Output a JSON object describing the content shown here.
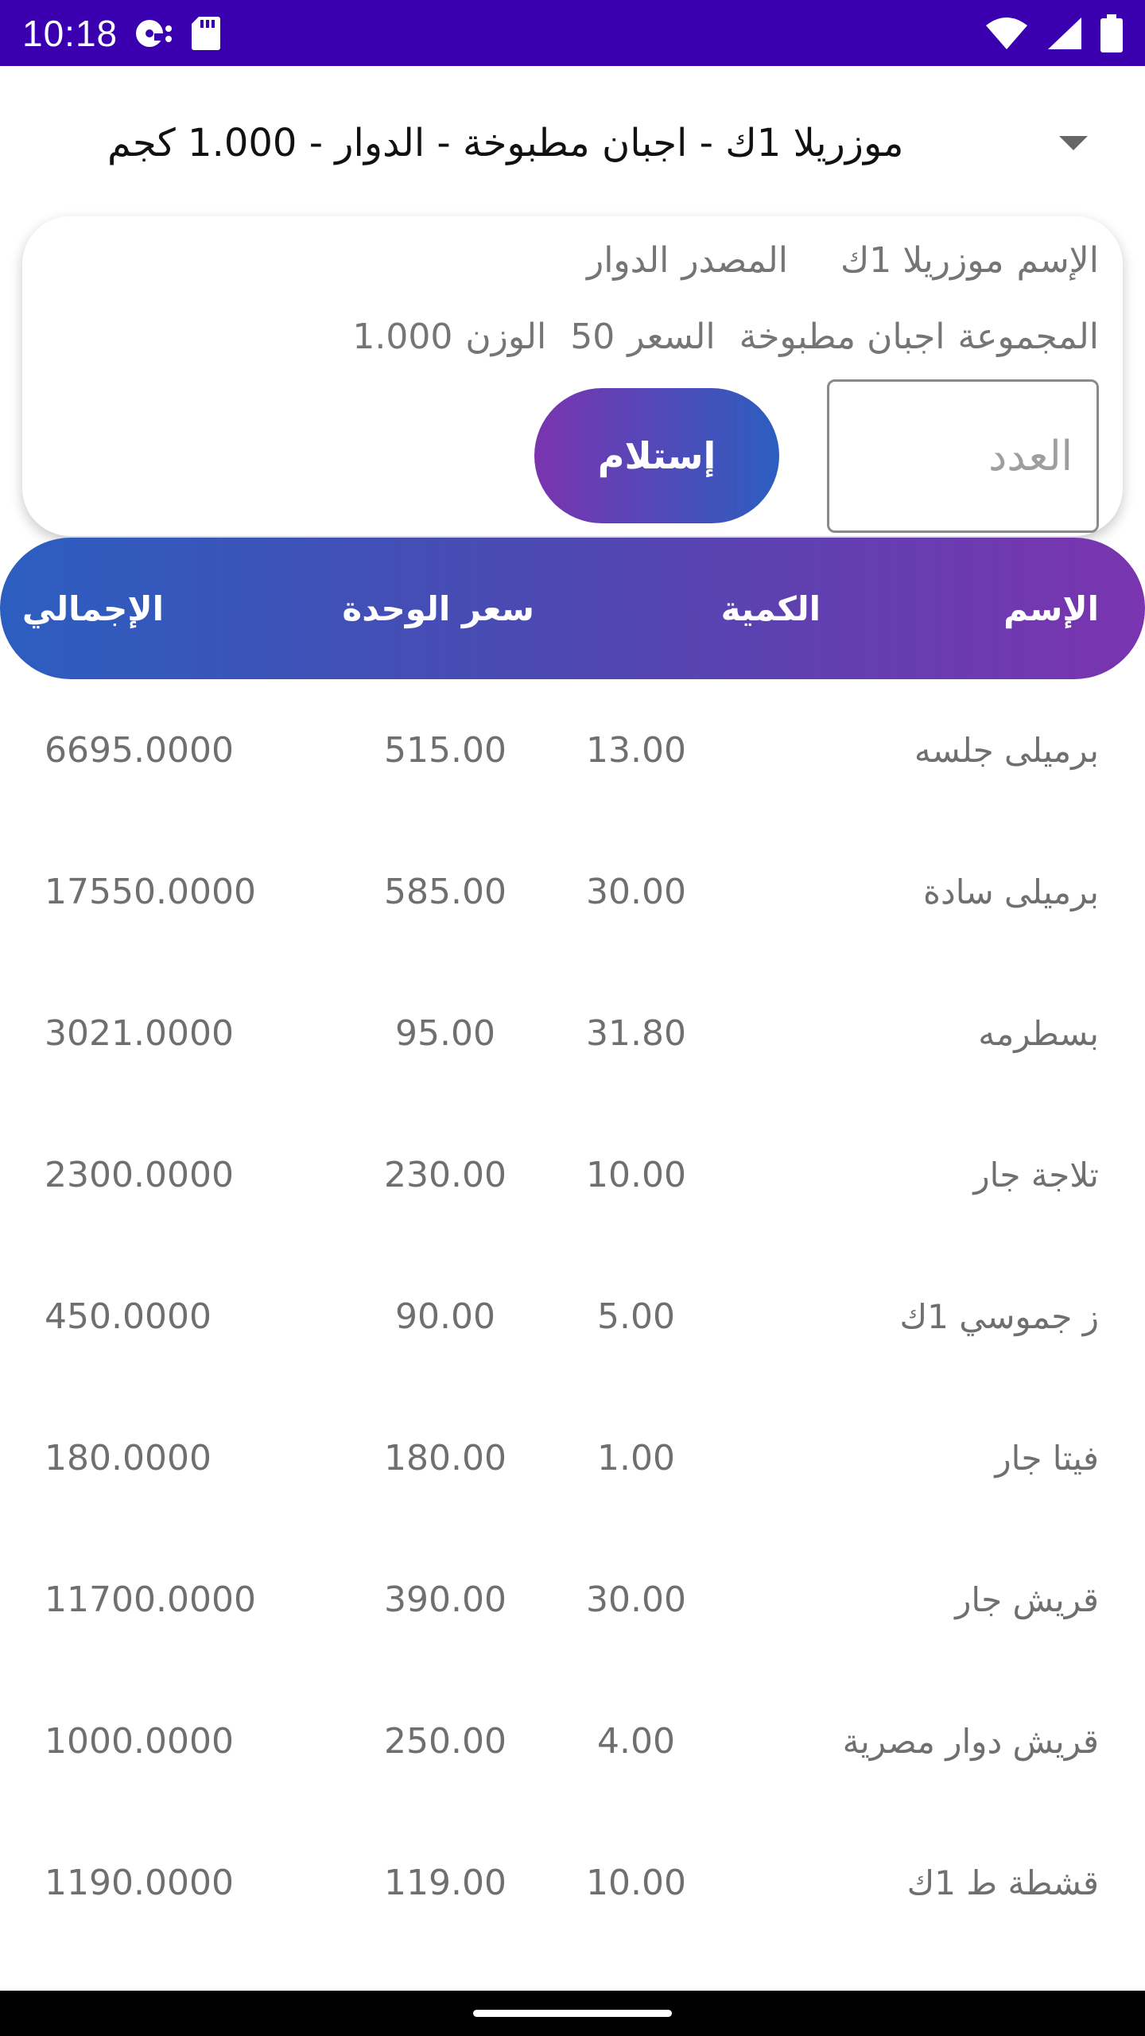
{
  "status_bar": {
    "time": "10:18",
    "icons": [
      "media-icon",
      "sd-card-icon",
      "wifi-icon",
      "signal-icon",
      "battery-icon"
    ],
    "background": "#3a00b0"
  },
  "spinner": {
    "selected": "موزريلا 1ك - اجبان مطبوخة - الدوار - 1.000 كجم",
    "arrow_icon": "dropdown-arrow-icon"
  },
  "card": {
    "name_label": "الإسم",
    "name_value": "موزريلا 1ك",
    "source_label": "المصدر",
    "source_value": "الدوار",
    "group_label": "المجموعة",
    "group_value": "اجبان مطبوخة",
    "price_label": "السعر",
    "price_value": "50",
    "weight_label": "الوزن",
    "weight_value": "1.000",
    "qty_placeholder": "العدد",
    "receive_label": "إستلام"
  },
  "table": {
    "headers": {
      "name": "الإسم",
      "qty": "الكمية",
      "unit_price": "سعر الوحدة",
      "total": "الإجمالي"
    },
    "rows": [
      {
        "name": "برميلى جلسه",
        "qty": "13.00",
        "price": "515.00",
        "total": "6695.0000"
      },
      {
        "name": "برميلى سادة",
        "qty": "30.00",
        "price": "585.00",
        "total": "17550.0000"
      },
      {
        "name": "بسطرمه",
        "qty": "31.80",
        "price": "95.00",
        "total": "3021.0000"
      },
      {
        "name": "تلاجة جار",
        "qty": "10.00",
        "price": "230.00",
        "total": "2300.0000"
      },
      {
        "name": "ز جموسي 1ك",
        "qty": "5.00",
        "price": "90.00",
        "total": "450.0000"
      },
      {
        "name": "فيتا جار",
        "qty": "1.00",
        "price": "180.00",
        "total": "180.0000"
      },
      {
        "name": "قريش جار",
        "qty": "30.00",
        "price": "390.00",
        "total": "11700.0000"
      },
      {
        "name": "قريش دوار مصرية",
        "qty": "4.00",
        "price": "250.00",
        "total": "1000.0000"
      },
      {
        "name": "قشطة ط 1ك",
        "qty": "10.00",
        "price": "119.00",
        "total": "1190.0000"
      }
    ]
  },
  "colors": {
    "gradient_start": "#2c5ec0",
    "gradient_end": "#7a34b0"
  }
}
